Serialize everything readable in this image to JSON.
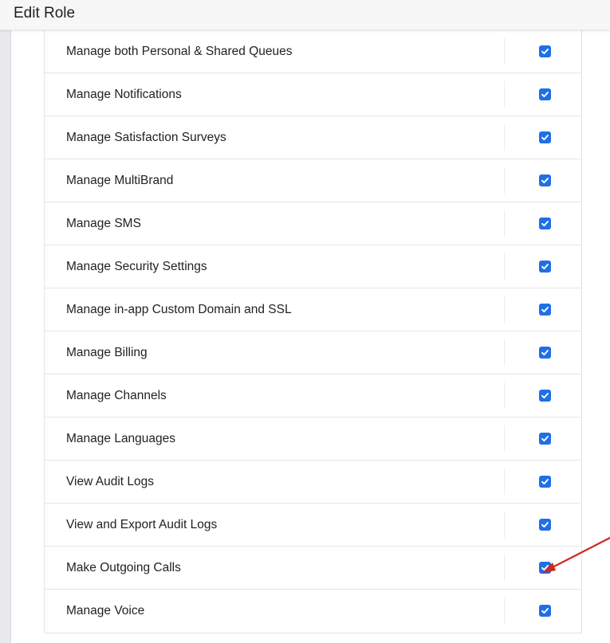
{
  "header": {
    "title": "Edit Role"
  },
  "permissions": [
    {
      "label": "Manage both Personal & Shared Queues",
      "checked": true
    },
    {
      "label": "Manage Notifications",
      "checked": true
    },
    {
      "label": "Manage Satisfaction Surveys",
      "checked": true
    },
    {
      "label": "Manage MultiBrand",
      "checked": true
    },
    {
      "label": "Manage SMS",
      "checked": true
    },
    {
      "label": "Manage Security Settings",
      "checked": true
    },
    {
      "label": "Manage in-app Custom Domain and SSL",
      "checked": true
    },
    {
      "label": "Manage Billing",
      "checked": true
    },
    {
      "label": "Manage Channels",
      "checked": true
    },
    {
      "label": "Manage Languages",
      "checked": true
    },
    {
      "label": "View Audit Logs",
      "checked": true
    },
    {
      "label": "View and Export Audit Logs",
      "checked": true
    },
    {
      "label": "Make Outgoing Calls",
      "checked": true
    },
    {
      "label": "Manage Voice",
      "checked": true
    }
  ],
  "colors": {
    "checkbox": "#1f6fe5",
    "annotation_arrow": "#d3261f"
  },
  "icons": {
    "checkbox": "checkmark-icon",
    "annotation": "red-arrow-icon"
  }
}
